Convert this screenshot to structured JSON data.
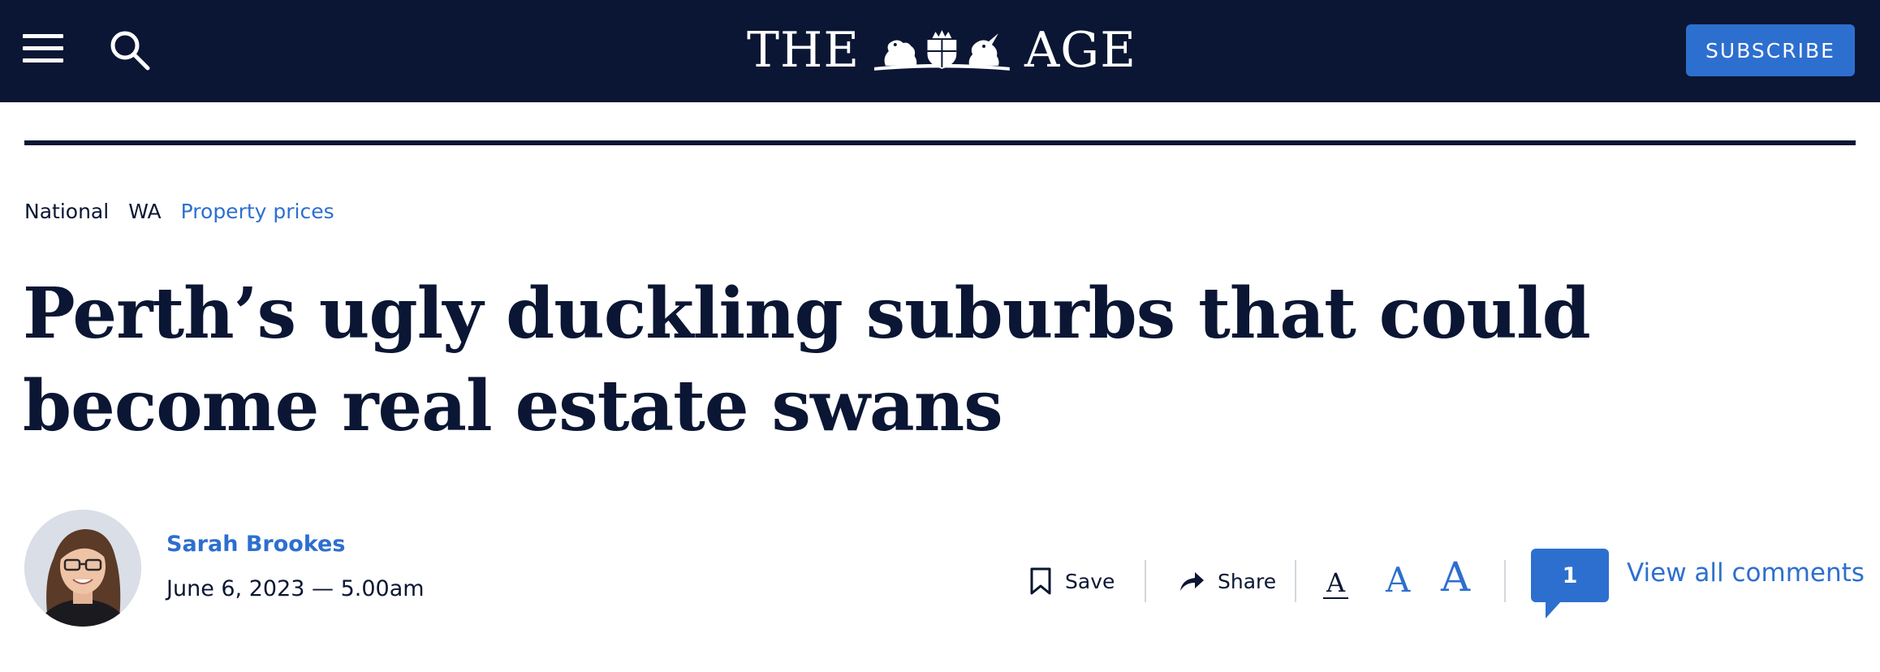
{
  "colors": {
    "navy": "#0a1633",
    "accent_blue": "#2d6fcf",
    "divider": "#d4d7dd",
    "white": "#ffffff"
  },
  "header": {
    "menu_icon": "hamburger-menu-icon",
    "search_icon": "search-icon",
    "masthead_left": "THE",
    "masthead_right": "AGE",
    "crest_icon": "coat-of-arms-crest",
    "subscribe_label": "SUBSCRIBE"
  },
  "breadcrumb": {
    "items": [
      {
        "label": "National"
      },
      {
        "label": "WA"
      },
      {
        "label": "Property prices"
      }
    ]
  },
  "article": {
    "headline": "Perth’s ugly duckling suburbs that could become real estate swans",
    "author": "Sarah Brookes",
    "date": "June 6, 2023 — 5.00am",
    "avatar_icon": "author-avatar"
  },
  "actions": {
    "save_label": "Save",
    "save_icon": "bookmark-icon",
    "share_label": "Share",
    "share_icon": "share-arrow-icon",
    "font_sizes": [
      "A",
      "A",
      "A"
    ],
    "comment_count": "1",
    "comments_label": "View all comments"
  }
}
